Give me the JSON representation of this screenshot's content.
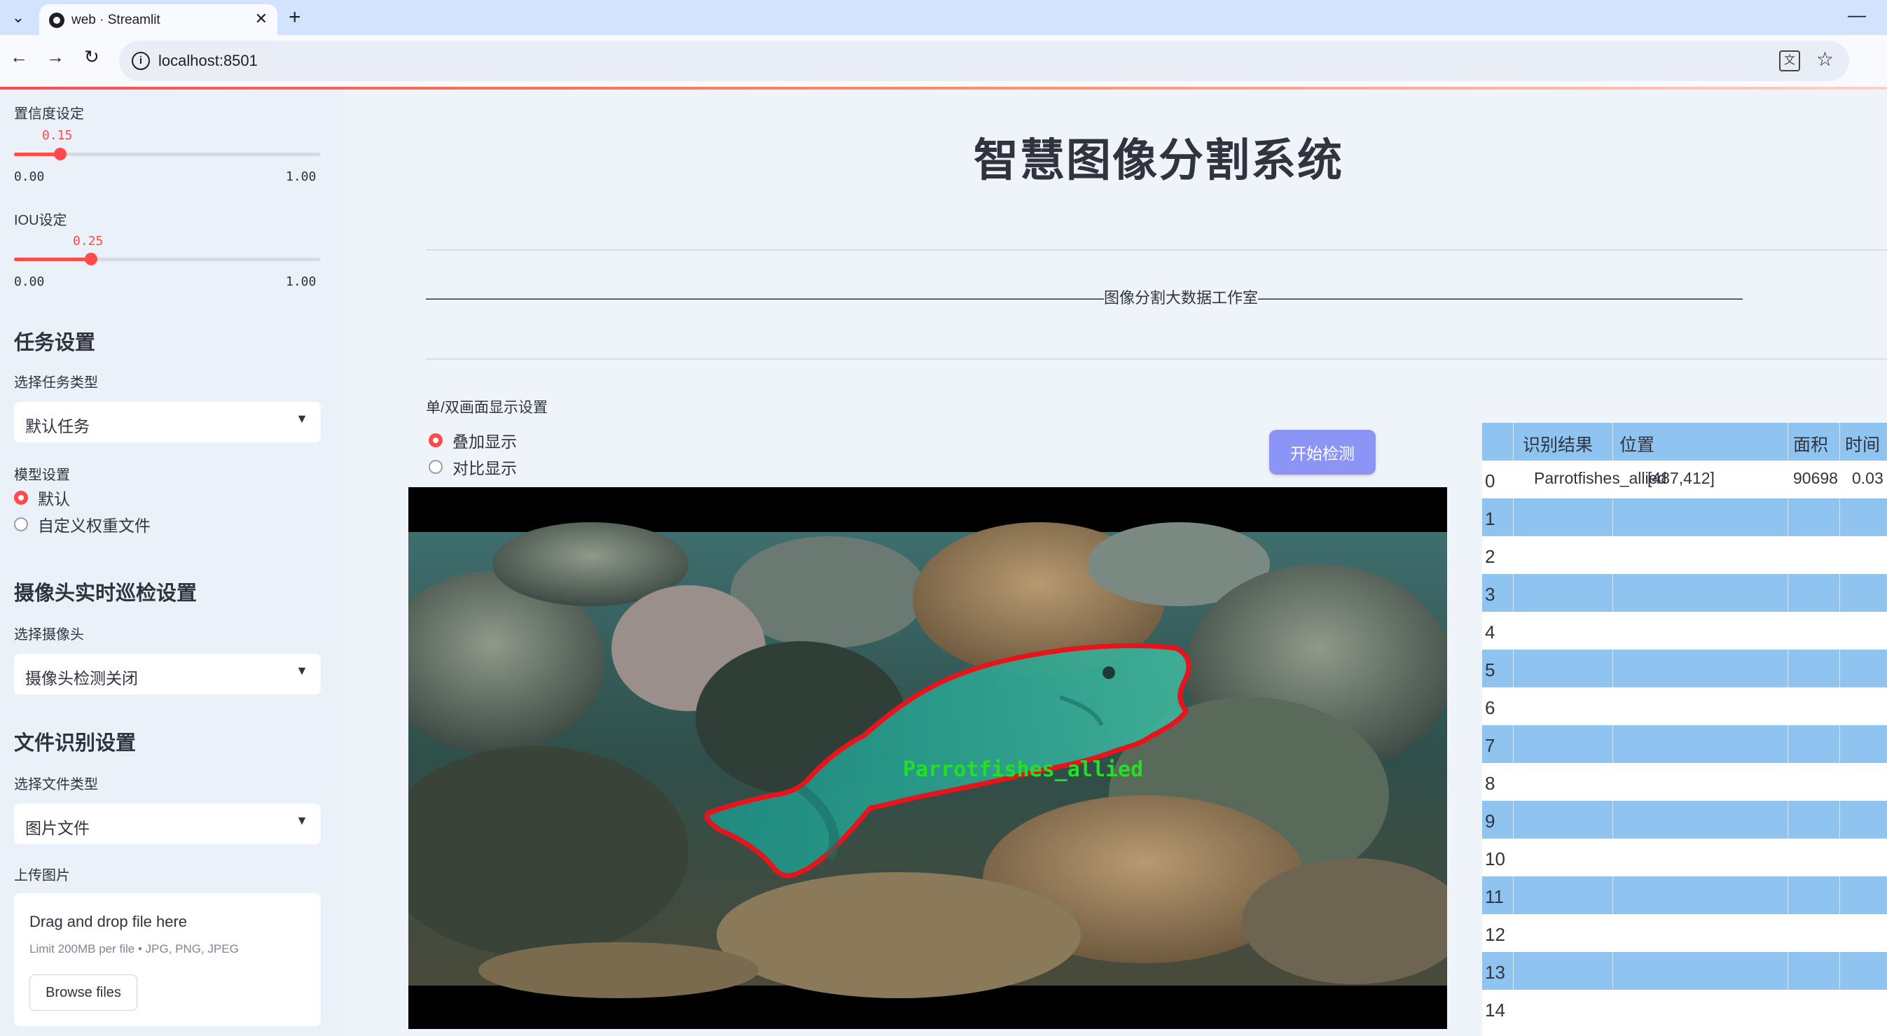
{
  "browser": {
    "tab_title": "web · Streamlit",
    "url": "localhost:8501"
  },
  "sidebar": {
    "confidence": {
      "label": "置信度设定",
      "value": "0.15",
      "min": "0.00",
      "max": "1.00",
      "fraction": 0.15
    },
    "iou": {
      "label": "IOU设定",
      "value": "0.25",
      "min": "0.00",
      "max": "1.00",
      "fraction": 0.25
    },
    "task_section": "任务设置",
    "task_type_label": "选择任务类型",
    "task_type_value": "默认任务",
    "model_label": "模型设置",
    "model_options": [
      "默认",
      "自定义权重文件"
    ],
    "camera_section": "摄像头实时巡检设置",
    "camera_label": "选择摄像头",
    "camera_value": "摄像头检测关闭",
    "file_section": "文件识别设置",
    "file_type_label": "选择文件类型",
    "file_type_value": "图片文件",
    "upload_label": "上传图片",
    "uploader": {
      "title": "Drag and drop file here",
      "subtitle": "Limit 200MB per file • JPG, PNG, JPEG",
      "button": "Browse files"
    }
  },
  "main": {
    "title": "智慧图像分割系统",
    "banner": "————————————————————————————————————————————图像分割大数据工作室——————————————————————————————————————————",
    "display_label": "单/双画面显示设置",
    "display_options": [
      "叠加显示",
      "对比显示"
    ],
    "detect_button": "开始检测",
    "detection_label": "Parrotfishes_allied"
  },
  "table": {
    "headers": [
      "识别结果",
      "位置",
      "面积",
      "时间"
    ],
    "rows": [
      {
        "idx": "0",
        "result": "Parrotfishes_allied",
        "pos": "[487,412]",
        "area": "90698",
        "time": "0.03"
      }
    ],
    "empty_indices": [
      "1",
      "2",
      "3",
      "4",
      "5",
      "6",
      "7",
      "8",
      "9",
      "10",
      "11",
      "12",
      "13",
      "14"
    ]
  },
  "colors": {
    "accent": "#ff4b4b",
    "button": "#8c95f5",
    "table_band": "#8fc4f0",
    "mask_outline": "#e8131b",
    "label_green": "#22e022"
  }
}
